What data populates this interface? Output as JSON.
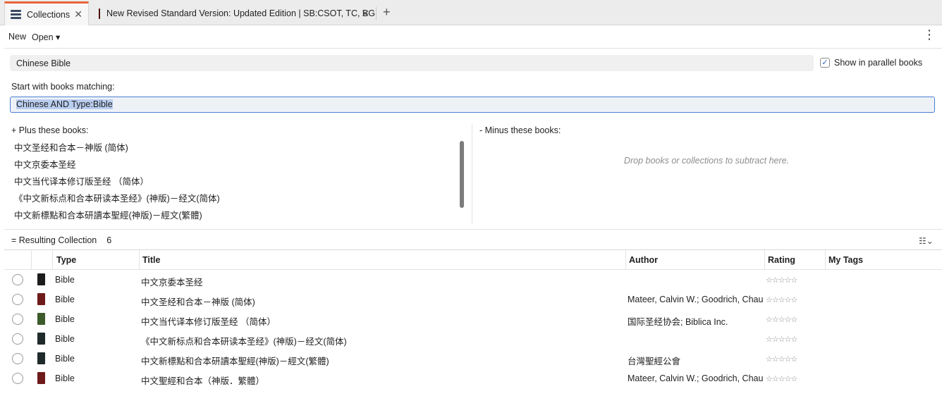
{
  "tabs": [
    {
      "label": "Collections",
      "icon": "collections-icon",
      "active": true
    },
    {
      "label": "New Revised Standard Version: Updated Edition | SB:CSOT, TC, BG",
      "icon": "book-icon",
      "active": false
    }
  ],
  "toolbar": {
    "new_label": "New",
    "open_label": "Open ▾"
  },
  "collection_name": "Chinese Bible",
  "parallel": {
    "label": "Show in parallel books",
    "checked": true
  },
  "start_label": "Start with  books matching:",
  "query": "Chinese AND Type:Bible",
  "plus": {
    "label": "+ Plus these books:",
    "items": [
      "中文圣经和合本－神版 (简体)",
      "中文京委本圣经",
      "中文当代译本修订版圣经 （简体）",
      "《中文新标点和合本研读本圣经》(神版)－经文(简体)",
      "中文新標點和合本研讀本聖經(神版)－經文(繁體)"
    ]
  },
  "minus": {
    "label": "-  Minus these books:",
    "hint": "Drop books or collections to subtract here."
  },
  "results": {
    "label": "= Resulting Collection",
    "count": "6",
    "columns": {
      "type": "Type",
      "title": "Title",
      "author": "Author",
      "rating": "Rating",
      "tags": "My Tags"
    },
    "rows": [
      {
        "type": "Bible",
        "title": "中文京委本圣经",
        "author": "",
        "rating": "☆☆☆☆☆",
        "cover_color": "#1c1c1c"
      },
      {
        "type": "Bible",
        "title": "中文圣经和合本－神版 (简体)",
        "author": "Mateer, Calvin W.; Goodrich, Chauncey",
        "rating": "☆☆☆☆☆",
        "cover_color": "#6e1a1a"
      },
      {
        "type": "Bible",
        "title": "中文当代译本修订版圣经 （简体）",
        "author": "国际圣经协会; Biblica Inc.",
        "rating": "☆☆☆☆☆",
        "cover_color": "#3d5a2a"
      },
      {
        "type": "Bible",
        "title": "《中文新标点和合本研读本圣经》(神版)－经文(简体)",
        "author": "",
        "rating": "☆☆☆☆☆",
        "cover_color": "#1f2a2a"
      },
      {
        "type": "Bible",
        "title": "中文新標點和合本研讀本聖經(神版)－經文(繁體)",
        "author": "台灣聖經公會",
        "rating": "☆☆☆☆☆",
        "cover_color": "#1f2a2a"
      },
      {
        "type": "Bible",
        "title": "中文聖經和合本（神版．繁體）",
        "author": "Mateer, Calvin W.; Goodrich, Chauncey",
        "rating": "☆☆☆☆☆",
        "cover_color": "#6e1a1a"
      }
    ]
  }
}
